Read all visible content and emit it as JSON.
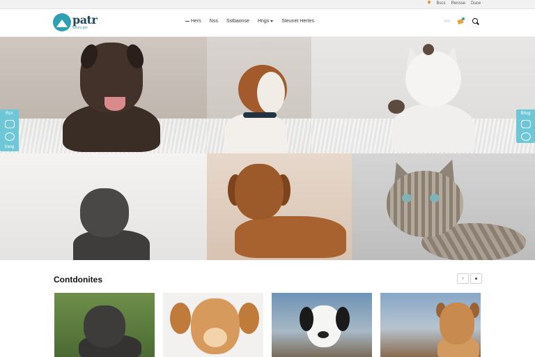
{
  "utility": {
    "links": [
      "Bscs",
      "Rensse",
      "Duce"
    ]
  },
  "header": {
    "logo_word": "patr",
    "logo_tagline": "luxury pet",
    "nav": [
      {
        "label": "Hers"
      },
      {
        "label": "Nss"
      },
      {
        "label": "Sstbaonse"
      },
      {
        "label": "Hngs"
      },
      {
        "label": "Steunet Hertes"
      }
    ],
    "tool_label": "Ino"
  },
  "side_left": {
    "label": "Rcn",
    "sub": "Irang"
  },
  "side_right": {
    "label": "Bhog"
  },
  "section": {
    "title": "Contdonites",
    "pager_prev": "›"
  },
  "colors": {
    "accent": "#2f9fb3",
    "side_widget": "#6ec7d6"
  }
}
